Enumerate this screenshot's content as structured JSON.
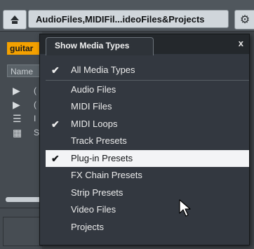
{
  "toolbar": {
    "path_text": "AudioFiles,MIDIFil...ideoFiles&Projects",
    "home_icon": "home-up-icon",
    "settings_icon": "gear-icon"
  },
  "browser": {
    "tag_label": "guitar",
    "column_header": "Name",
    "rows": [
      {
        "icon": "play-triangle-icon",
        "glyph": "▶",
        "label": "("
      },
      {
        "icon": "play-triangle-icon",
        "glyph": "▶",
        "label": "("
      },
      {
        "icon": "list-icon",
        "glyph": "☰",
        "label": "I"
      },
      {
        "icon": "grid-icon",
        "glyph": "▦",
        "label": "S"
      }
    ]
  },
  "popup": {
    "title": "Show Media Types",
    "close_label": "x",
    "all_item": {
      "label": "All Media Types",
      "checked": true
    },
    "items": [
      {
        "label": "Audio Files",
        "checked": false,
        "highlighted": false
      },
      {
        "label": "MIDI Files",
        "checked": false,
        "highlighted": false
      },
      {
        "label": "MIDI Loops",
        "checked": true,
        "highlighted": false
      },
      {
        "label": "Track Presets",
        "checked": false,
        "highlighted": false
      },
      {
        "label": "Plug-in Presets",
        "checked": true,
        "highlighted": true
      },
      {
        "label": "FX Chain Presets",
        "checked": false,
        "highlighted": false
      },
      {
        "label": "Strip Presets",
        "checked": false,
        "highlighted": false
      },
      {
        "label": "Video Files",
        "checked": false,
        "highlighted": false
      },
      {
        "label": "Projects",
        "checked": false,
        "highlighted": false
      }
    ],
    "check_glyph": "✔"
  },
  "colors": {
    "tag_accent": "#f4a100",
    "highlight_bg": "#f3f4f6",
    "popup_bg": "#333840"
  }
}
